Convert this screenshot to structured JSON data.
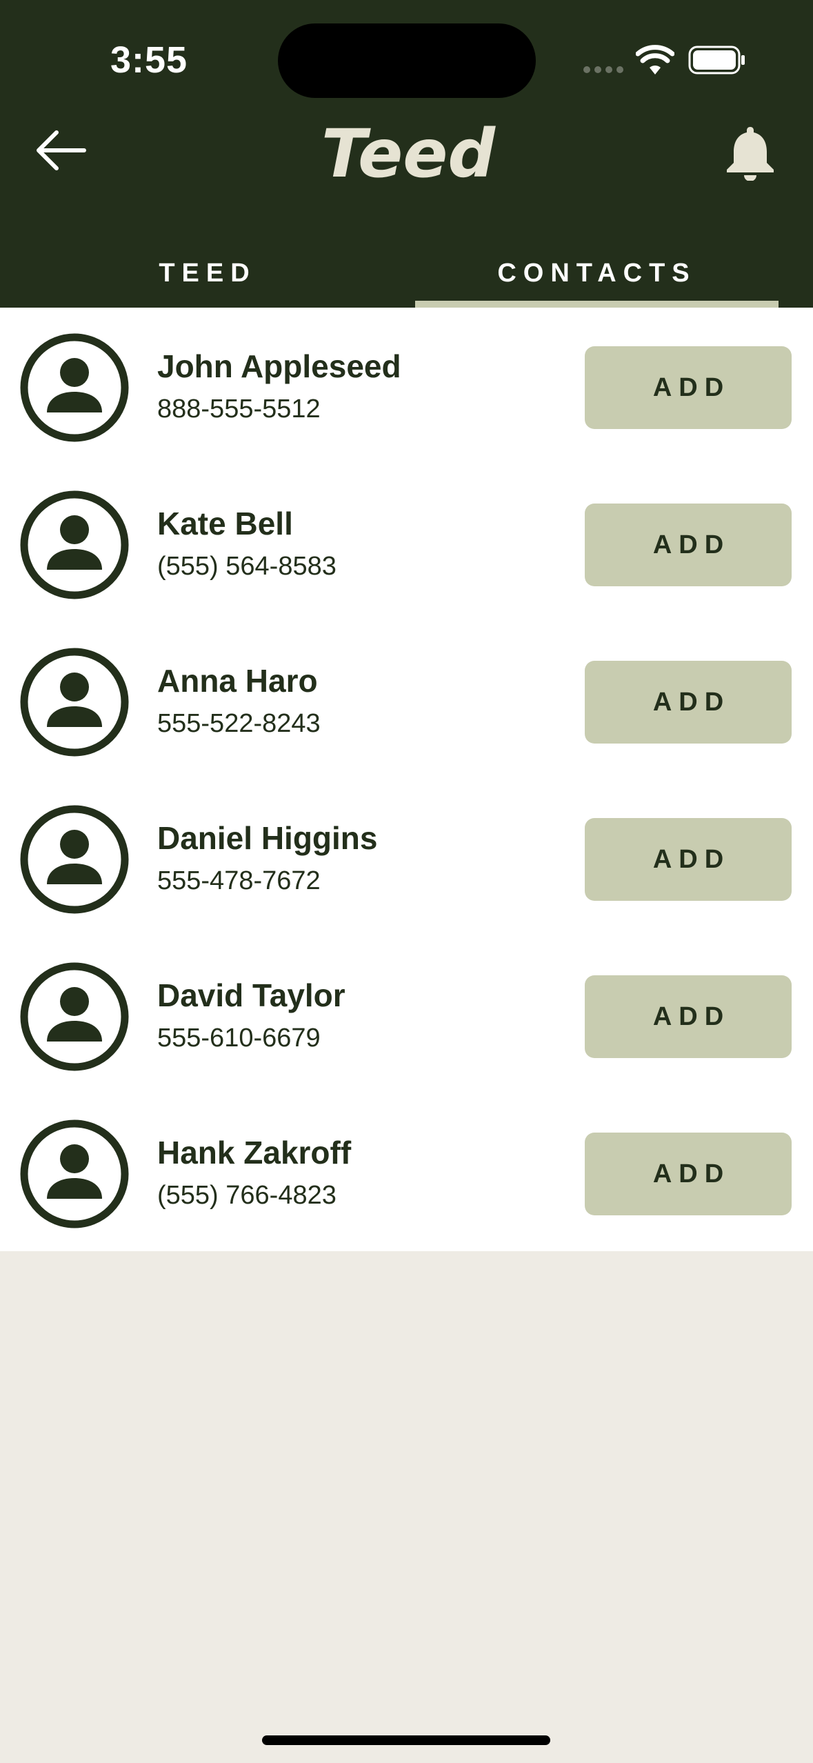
{
  "status_bar": {
    "time": "3:55"
  },
  "header": {
    "back_icon": "arrow-left-icon",
    "logo": "Teed",
    "bell_icon": "bell-icon",
    "background": "#232F1B"
  },
  "tabs": [
    {
      "label": "TEED",
      "active": false
    },
    {
      "label": "CONTACTS",
      "active": true
    }
  ],
  "contacts": [
    {
      "name": "John Appleseed",
      "phone": "888-555-5512",
      "action": "ADD"
    },
    {
      "name": "Kate Bell",
      "phone": "(555) 564-8583",
      "action": "ADD"
    },
    {
      "name": "Anna Haro",
      "phone": "555-522-8243",
      "action": "ADD"
    },
    {
      "name": "Daniel Higgins",
      "phone": "555-478-7672",
      "action": "ADD"
    },
    {
      "name": "David Taylor",
      "phone": "555-610-6679",
      "action": "ADD"
    },
    {
      "name": "Hank Zakroff",
      "phone": "(555) 766-4823",
      "action": "ADD"
    }
  ],
  "colors": {
    "primary_dark": "#232F1B",
    "accent_sage": "#C8CCB0",
    "background_cream": "#EEEBE4",
    "list_background": "#FFFFFF"
  }
}
